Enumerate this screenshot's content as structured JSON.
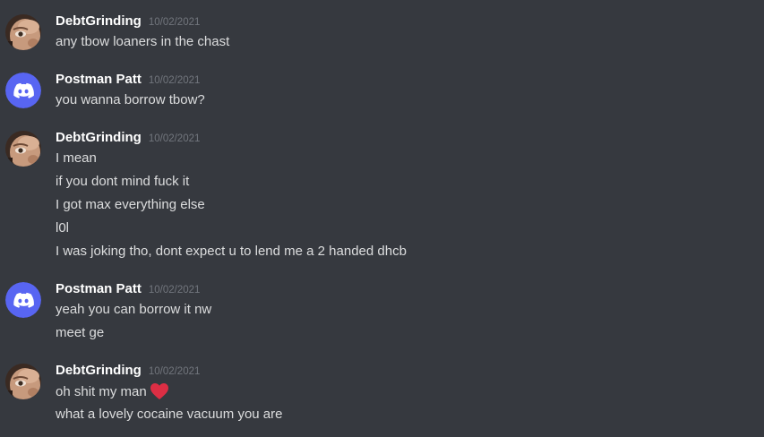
{
  "messages": [
    {
      "author": "DebtGrinding",
      "timestamp": "10/02/2021",
      "avatar": "user-photo-avatar",
      "lines": [
        "any tbow loaners in the chast"
      ]
    },
    {
      "author": "Postman Patt",
      "timestamp": "10/02/2021",
      "avatar": "discord-logo-avatar",
      "lines": [
        "you wanna borrow tbow?"
      ]
    },
    {
      "author": "DebtGrinding",
      "timestamp": "10/02/2021",
      "avatar": "user-photo-avatar",
      "lines": [
        "I mean",
        "if you dont mind fuck it",
        "I got max everything else",
        "l0l",
        "I was joking tho, dont expect u to lend me a 2 handed dhcb"
      ]
    },
    {
      "author": "Postman Patt",
      "timestamp": "10/02/2021",
      "avatar": "discord-logo-avatar",
      "lines": [
        "yeah you can borrow it nw",
        "meet ge"
      ]
    },
    {
      "author": "DebtGrinding",
      "timestamp": "10/02/2021",
      "avatar": "user-photo-avatar",
      "lines": [
        "oh shit my man",
        "what a lovely cocaine vacuum you are"
      ],
      "emoji": "red-heart-emoji"
    }
  ],
  "colors": {
    "background": "#36393f",
    "username": "#ffffff",
    "message_text": "#dcddde",
    "timestamp": "#72767d",
    "discord_blurple": "#5865f2",
    "heart": "#dd2e44"
  }
}
